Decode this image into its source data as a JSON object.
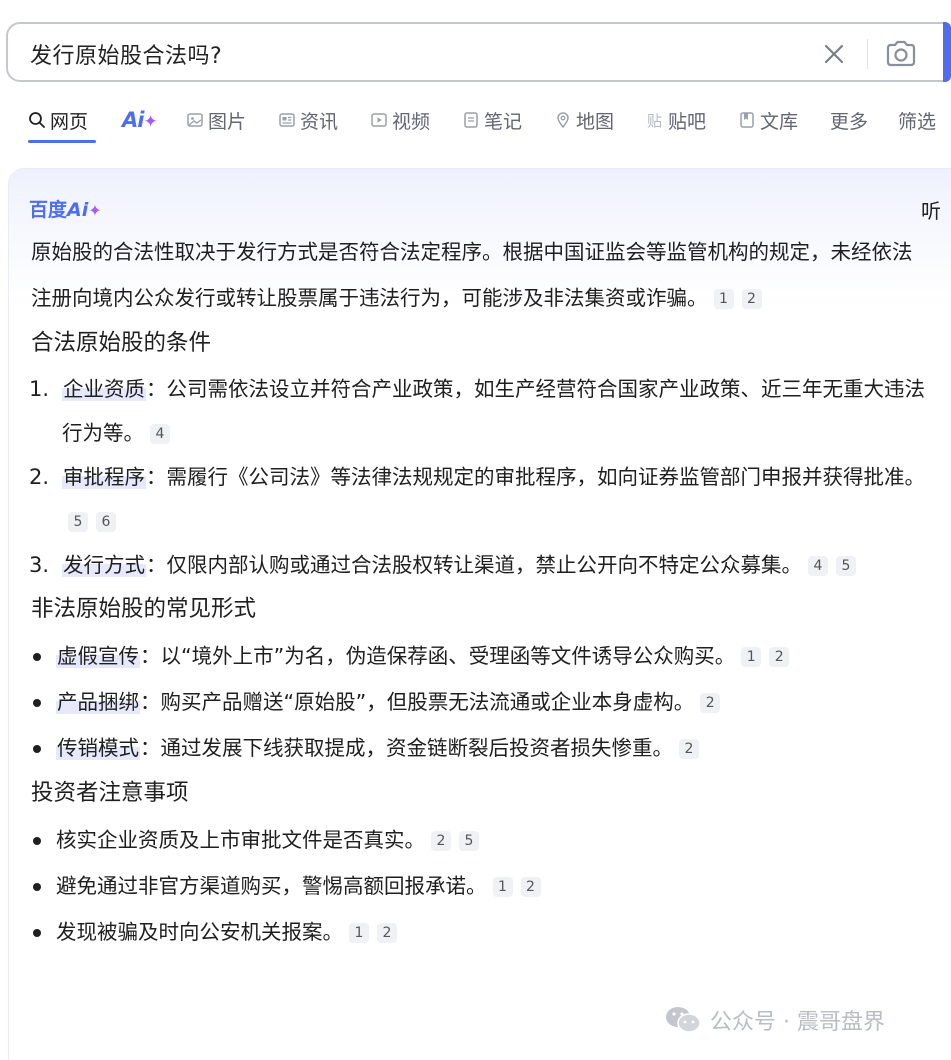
{
  "search": {
    "query": "发行原始股合法吗?"
  },
  "tabs": [
    {
      "label": "网页",
      "icon": "search-icon",
      "active": true
    },
    {
      "label": "Ai",
      "icon": "ai-star-icon",
      "active": false
    },
    {
      "label": "图片",
      "icon": "image-icon",
      "active": false
    },
    {
      "label": "资讯",
      "icon": "news-icon",
      "active": false
    },
    {
      "label": "视频",
      "icon": "video-icon",
      "active": false
    },
    {
      "label": "笔记",
      "icon": "note-icon",
      "active": false
    },
    {
      "label": "地图",
      "icon": "map-icon",
      "active": false
    },
    {
      "label": "贴吧",
      "icon": "tieba-icon",
      "active": false
    },
    {
      "label": "文库",
      "icon": "wenku-icon",
      "active": false
    },
    {
      "label": "更多",
      "icon": "",
      "active": false
    },
    {
      "label": "筛选",
      "icon": "",
      "active": false
    }
  ],
  "ai_card": {
    "brand_prefix": "百度",
    "brand_ai": "Ai",
    "listen": "听",
    "intro": "原始股的合法性取决于发行方式是否符合法定程序。根据中国证监会等监管机构的规定，未经依法注册向境内公众发行或转让股票属于违法行为，可能涉及非法集资或诈骗。",
    "intro_cites": [
      "1",
      "2"
    ],
    "section1": {
      "title": "合法原始股的条件",
      "items": [
        {
          "num": "1.",
          "key": "企业资质",
          "text": "：公司需依法设立并符合产业政策，如生产经营符合国家产业政策、近三年无重大违法行为等。",
          "cites": [
            "4"
          ]
        },
        {
          "num": "2.",
          "key": "审批程序",
          "text": "：需履行《公司法》等法律法规规定的审批程序，如向证券监管部门申报并获得批准。",
          "cites": [
            "5",
            "6"
          ]
        },
        {
          "num": "3.",
          "key": "发行方式",
          "text": "：仅限内部认购或通过合法股权转让渠道，禁止公开向不特定公众募集。",
          "cites": [
            "4",
            "5"
          ]
        }
      ]
    },
    "section2": {
      "title": "非法原始股的常见形式",
      "items": [
        {
          "key": "虚假宣传",
          "text": "：以“境外上市”为名，伪造保荐函、受理函等文件诱导公众购买。",
          "cites": [
            "1",
            "2"
          ]
        },
        {
          "key": "产品捆绑",
          "text": "：购买产品赠送“原始股”，但股票无法流通或企业本身虚构。",
          "cites": [
            "2"
          ]
        },
        {
          "key": "传销模式",
          "text": "：通过发展下线获取提成，资金链断裂后投资者损失惨重。",
          "cites": [
            "2"
          ]
        }
      ]
    },
    "section3": {
      "title": "投资者注意事项",
      "items": [
        {
          "text": "核实企业资质及上市审批文件是否真实。",
          "cites": [
            "2",
            "5"
          ]
        },
        {
          "text": "避免通过非官方渠道购买，警惕高额回报承诺。",
          "cites": [
            "1",
            "2"
          ]
        },
        {
          "text": "发现被骗及时向公安机关报案。",
          "cites": [
            "1",
            "2"
          ]
        }
      ]
    }
  },
  "watermark": "公众号 · 震哥盘界",
  "colors": {
    "accent": "#4e6ef2",
    "ai_star": "#a55cf6",
    "tab_text": "#626675",
    "highlight": "#e6e9fc"
  }
}
